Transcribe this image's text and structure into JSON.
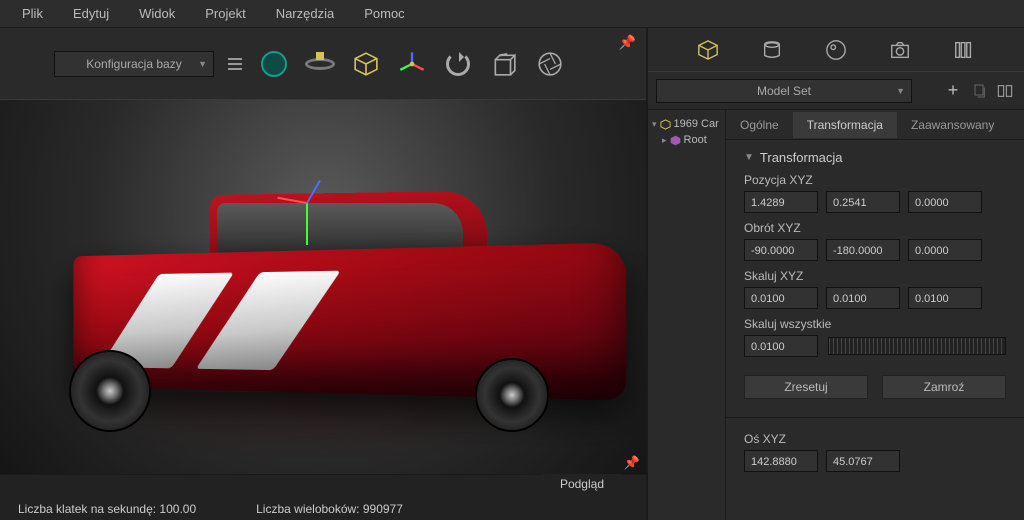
{
  "menu": {
    "items": [
      "Plik",
      "Edytuj",
      "Widok",
      "Projekt",
      "Narzędzia",
      "Pomoc"
    ]
  },
  "toolbar": {
    "config_label": "Konfiguracja bazy"
  },
  "viewport": {
    "preview_label": "Podgląd"
  },
  "status": {
    "fps": "Liczba klatek na sekundę: 100.00",
    "polys": "Liczba wieloboków: 990977"
  },
  "right": {
    "model_set": "Model Set",
    "tree": [
      {
        "label": "1969 Car"
      },
      {
        "label": "Root"
      }
    ],
    "tabs": [
      "Ogólne",
      "Transformacja",
      "Zaawansowany"
    ],
    "section": "Transformacja",
    "position_label": "Pozycja XYZ",
    "position": [
      "1.4289",
      "0.2541",
      "0.0000"
    ],
    "rotation_label": "Obrót XYZ",
    "rotation": [
      "-90.0000",
      "-180.0000",
      "0.0000"
    ],
    "scale_label": "Skaluj XYZ",
    "scale": [
      "0.0100",
      "0.0100",
      "0.0100"
    ],
    "scale_all_label": "Skaluj wszystkie",
    "scale_all": "0.0100",
    "reset": "Zresetuj",
    "freeze": "Zamroź",
    "axis_label": "Oś XYZ",
    "axis": [
      "142.8880",
      "45.0767"
    ]
  }
}
